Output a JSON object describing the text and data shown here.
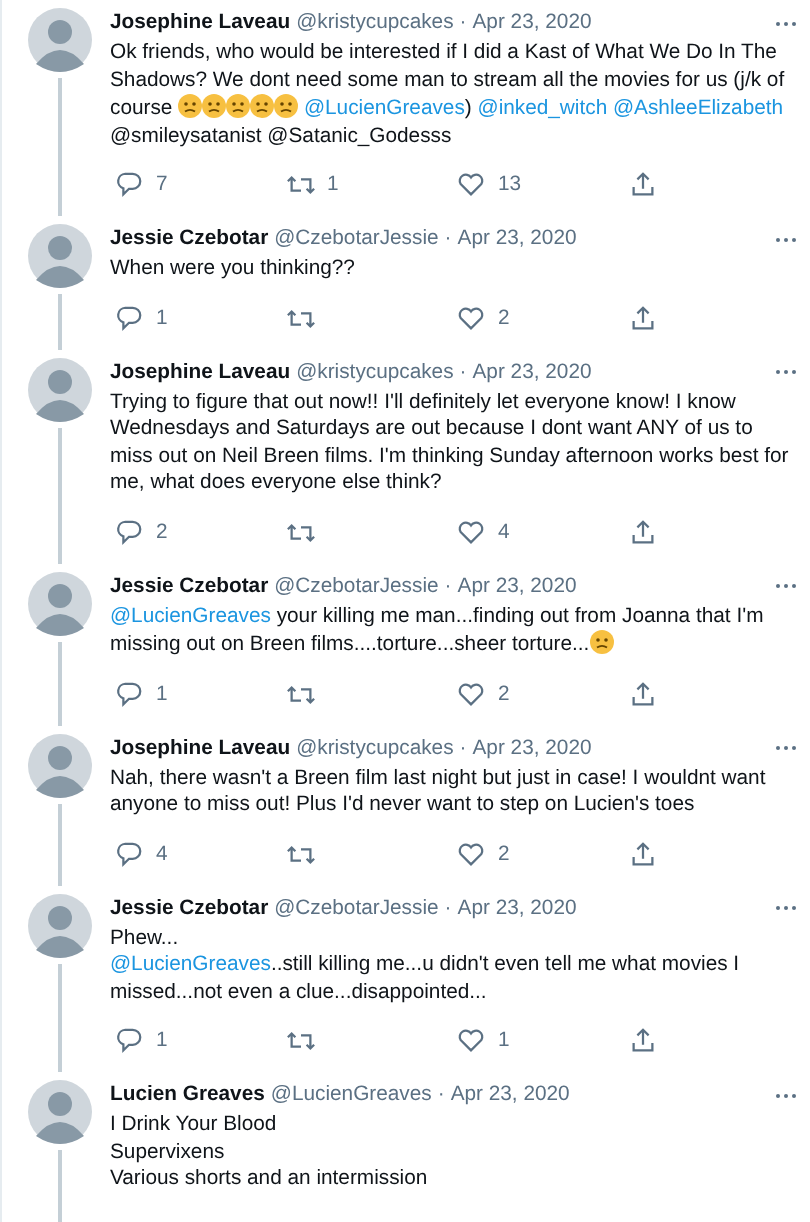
{
  "tweets": [
    {
      "name": "Josephine Laveau",
      "handle": "@kristycupcakes",
      "separator": "·",
      "date": "Apr 23, 2020",
      "paragraphs": [
        [
          {
            "kind": "text",
            "text": "Ok friends, who would be interested if I did a Kast of What We Do In The Shadows? We dont need some man to stream all the movies for us (j/k of course "
          },
          {
            "kind": "emoji"
          },
          {
            "kind": "emoji"
          },
          {
            "kind": "emoji"
          },
          {
            "kind": "emoji"
          },
          {
            "kind": "emoji"
          },
          {
            "kind": "mention",
            "text": " @LucienGreaves"
          },
          {
            "kind": "text",
            "text": ")  "
          },
          {
            "kind": "mention",
            "text": "@inked_witch"
          },
          {
            "kind": "mention",
            "text": " @AshleeElizabeth"
          },
          {
            "kind": "text",
            "text": " @smileysatanist @Satanic_Godesss"
          }
        ]
      ],
      "replies": "7",
      "retweets": "1",
      "likes": "13"
    },
    {
      "name": "Jessie Czebotar",
      "handle": "@CzebotarJessie",
      "separator": "·",
      "date": "Apr 23, 2020",
      "paragraphs": [
        [
          {
            "kind": "text",
            "text": "When were you thinking??"
          }
        ]
      ],
      "replies": "1",
      "likes": "2"
    },
    {
      "name": "Josephine Laveau",
      "handle": "@kristycupcakes",
      "separator": "·",
      "date": "Apr 23, 2020",
      "paragraphs": [
        [
          {
            "kind": "text",
            "text": "Trying to figure that out now!! I'll definitely let everyone know! I know Wednesdays and Saturdays are out because I dont want ANY of us to miss out on Neil Breen films. I'm thinking Sunday afternoon works best for me, what does everyone else think?"
          }
        ]
      ],
      "replies": "2",
      "likes": "4"
    },
    {
      "name": "Jessie Czebotar",
      "handle": "@CzebotarJessie",
      "separator": "·",
      "date": "Apr 23, 2020",
      "paragraphs": [
        [
          {
            "kind": "mention",
            "text": "@LucienGreaves"
          },
          {
            "kind": "text",
            "text": " your killing me man...finding out from Joanna that I'm missing out on Breen films....torture...sheer torture..."
          },
          {
            "kind": "emoji"
          }
        ]
      ],
      "replies": "1",
      "likes": "2"
    },
    {
      "name": "Josephine Laveau",
      "handle": "@kristycupcakes",
      "separator": "·",
      "date": "Apr 23, 2020",
      "paragraphs": [
        [
          {
            "kind": "text",
            "text": "Nah, there wasn't a Breen film last night but just in case! I wouldnt want anyone to miss out! Plus I'd never want to step on Lucien's toes"
          }
        ]
      ],
      "replies": "4",
      "likes": "2"
    },
    {
      "name": "Jessie Czebotar",
      "handle": "@CzebotarJessie",
      "separator": "·",
      "date": "Apr 23, 2020",
      "paragraphs": [
        [
          {
            "kind": "text",
            "text": "Phew..."
          }
        ],
        [
          {
            "kind": "mention",
            "text": "@LucienGreaves"
          },
          {
            "kind": "text",
            "text": "..still killing me...u didn't even tell me what movies I missed...not even a clue...disappointed..."
          }
        ]
      ],
      "replies": "1",
      "likes": "1"
    },
    {
      "name": "Lucien Greaves",
      "handle": "@LucienGreaves",
      "separator": "·",
      "date": "Apr 23, 2020",
      "paragraphs": [
        [
          {
            "kind": "text",
            "text": "I Drink Your Blood"
          }
        ],
        [
          {
            "kind": "text",
            "text": "Supervixens"
          }
        ],
        [
          {
            "kind": "text",
            "text": "Various shorts and an intermission"
          }
        ]
      ]
    }
  ]
}
